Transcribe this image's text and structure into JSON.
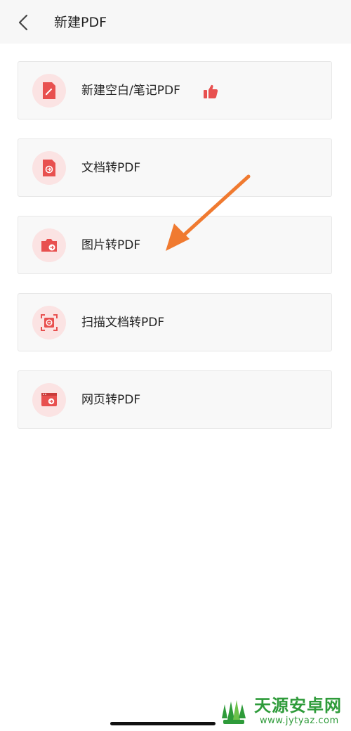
{
  "header": {
    "title": "新建PDF",
    "back_icon": "chevron-left-icon"
  },
  "items": [
    {
      "label": "新建空白/笔记PDF",
      "icon": "pen-document-icon",
      "badge_icon": "thumbs-up-icon"
    },
    {
      "label": "文档转PDF",
      "icon": "file-convert-icon"
    },
    {
      "label": "图片转PDF",
      "icon": "camera-convert-icon"
    },
    {
      "label": "扫描文档转PDF",
      "icon": "scan-document-icon"
    },
    {
      "label": "网页转PDF",
      "icon": "webpage-convert-icon"
    }
  ],
  "colors": {
    "accent": "#e8504f",
    "icon_bg": "#fbe3e3",
    "annotation_arrow": "#f07a30"
  },
  "watermark": {
    "title": "天源安卓网",
    "url": "www.jytyaz.com"
  }
}
